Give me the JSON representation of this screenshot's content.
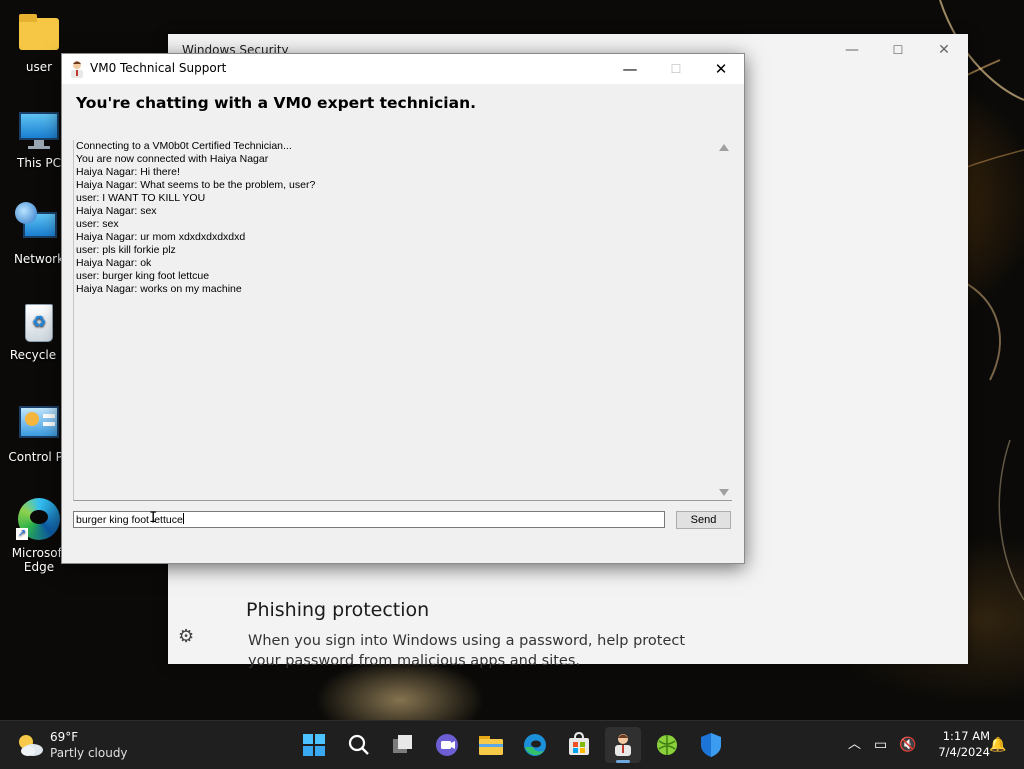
{
  "desktop": {
    "icons": [
      {
        "label": "user"
      },
      {
        "label": "This PC"
      },
      {
        "label": "Network"
      },
      {
        "label": "Recycle B"
      },
      {
        "label": "Control Pa"
      },
      {
        "label": "Microsoft Edge"
      }
    ]
  },
  "background_window": {
    "title": "Windows Security",
    "section_heading": "Phishing protection",
    "section_text": "When you sign into Windows using a password, help protect your password from malicious apps and sites."
  },
  "chat_window": {
    "title": "VM0 Technical Support",
    "heading": "You're chatting with a VM0 expert technician.",
    "messages": [
      "Connecting to a VM0b0t Certified Technician...",
      "You are now connected with Haiya Nagar",
      "Haiya Nagar: Hi there!",
      "Haiya Nagar: What seems to be the problem, user?",
      "user: I WANT TO KILL YOU",
      "Haiya Nagar: sex",
      "user: sex",
      "Haiya Nagar: ur mom xdxdxdxdxdxd",
      "user: pls kill forkie plz",
      "Haiya Nagar: ok",
      "user: burger king foot lettcue",
      "Haiya Nagar: works on my machine"
    ],
    "input_value": "burger king foot lettuce",
    "send_label": "Send",
    "controls": {
      "minimize": "—",
      "maximize": "☐",
      "close": "✕"
    }
  },
  "taskbar": {
    "weather_temp": "69°F",
    "weather_desc": "Partly cloudy",
    "time": "1:17 AM",
    "date": "7/4/2024"
  },
  "colors": {
    "taskbar_bg": "#1f1f1f",
    "accent": "#0078d4"
  }
}
